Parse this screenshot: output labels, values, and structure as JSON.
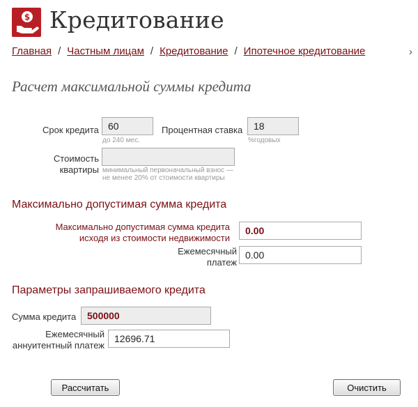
{
  "header": {
    "title": "Кредитование",
    "logo_icon": "hand-money-icon",
    "brand_color": "#b81f24"
  },
  "breadcrumb": {
    "items": [
      "Главная",
      "Частным лицам",
      "Кредитование",
      "Ипотечное кредитование"
    ],
    "separator": "/",
    "more_icon": "chevron-right-icon"
  },
  "section": {
    "title": "Расчет максимальной суммы кредита"
  },
  "form": {
    "term": {
      "label": "Срок кредита",
      "value": "60",
      "hint": "до 240 мес."
    },
    "rate": {
      "label": "Процентная ставка",
      "value": "18",
      "hint": "%годовых"
    },
    "cost": {
      "label_line1": "Стоимость",
      "label_line2": "квартиры",
      "value": "",
      "hint_line1": "минимальный первоначальный взнос —",
      "hint_line2": "не менее 20% от стоимости квартиры"
    }
  },
  "max_section": {
    "title": "Максимально допустимая сумма кредита",
    "max_by_property": {
      "label_line1": "Максимально допустимая сумма кредита",
      "label_line2": "исходя из стоимости недвижимости",
      "value": "0.00"
    },
    "monthly": {
      "label_line1": "Ежемесячный",
      "label_line2": "платеж",
      "value": "0.00"
    }
  },
  "params_section": {
    "title": "Параметры запрашиваемого кредита",
    "amount": {
      "label": "Сумма кредита",
      "value": "500000"
    },
    "annuity": {
      "label_line1": "Ежемесячный",
      "label_line2": "аннуитентный платеж",
      "value": "12696.71"
    }
  },
  "buttons": {
    "calculate": "Рассчитать",
    "clear": "Очистить"
  }
}
